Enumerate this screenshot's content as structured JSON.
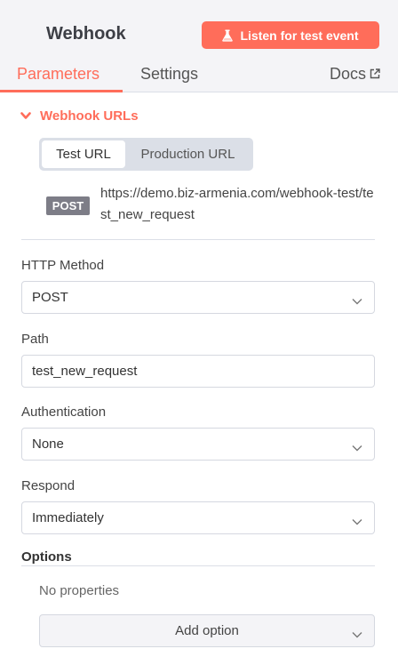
{
  "header": {
    "title": "Webhook",
    "listen_button": "Listen for test event",
    "tabs": [
      {
        "label": "Parameters",
        "active": true
      },
      {
        "label": "Settings",
        "active": false
      }
    ],
    "docs_label": "Docs"
  },
  "webhook_urls": {
    "section_label": "Webhook URLs",
    "url_types": [
      "Test URL",
      "Production URL"
    ],
    "selected_url_type": "Test URL",
    "method": "POST",
    "url": "https://demo.biz-armenia.com/webhook-test/test_new_request"
  },
  "fields": {
    "http_method": {
      "label": "HTTP Method",
      "value": "POST"
    },
    "path": {
      "label": "Path",
      "value": "test_new_request"
    },
    "authentication": {
      "label": "Authentication",
      "value": "None"
    },
    "respond": {
      "label": "Respond",
      "value": "Immediately"
    }
  },
  "options": {
    "title": "Options",
    "empty_text": "No properties",
    "add_button": "Add option"
  },
  "colors": {
    "accent": "#ff6d5a",
    "header_bg": "#f4f4f7",
    "badge_bg": "#7d7d87"
  }
}
